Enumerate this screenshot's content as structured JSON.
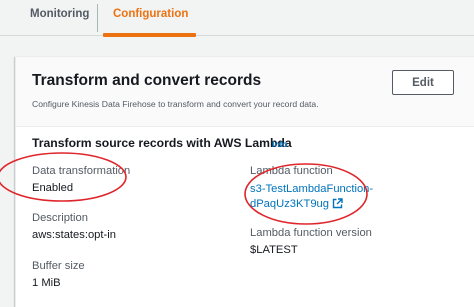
{
  "tabs": [
    {
      "label": "Monitoring"
    },
    {
      "label": "Configuration"
    }
  ],
  "panel": {
    "title": "Transform and convert records",
    "description": "Configure Kinesis Data Firehose to transform and convert your record data.",
    "edit_label": "Edit"
  },
  "section": {
    "title": "Transform source records with AWS Lambda",
    "info_label": "Info"
  },
  "fields": {
    "data_transformation": {
      "label": "Data transformation",
      "value": "Enabled"
    },
    "description": {
      "label": "Description",
      "value": "aws:states:opt-in"
    },
    "buffer_size": {
      "label": "Buffer size",
      "value": "1 MiB"
    },
    "lambda_function": {
      "label": "Lambda function",
      "line1": "s3-TestLambdaFunction-",
      "line2": "dPaqUz3KT9ug"
    },
    "lambda_version": {
      "label": "Lambda function version",
      "value": "$LATEST"
    }
  },
  "colors": {
    "accent": "#ec7211",
    "link": "#0073bb",
    "annotation": "#e0252a"
  }
}
